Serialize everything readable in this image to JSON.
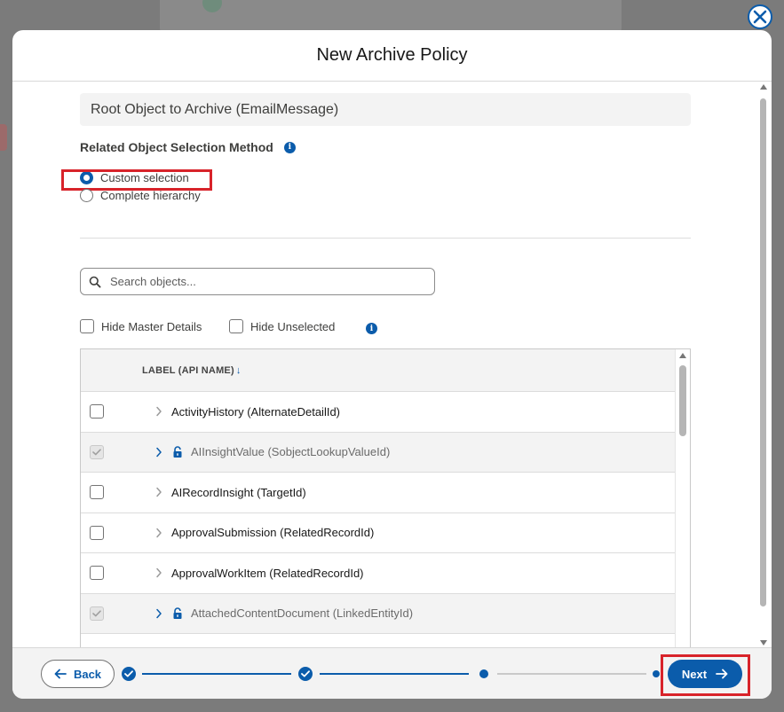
{
  "modal": {
    "title": "New Archive Policy"
  },
  "root_object": {
    "label": "Root Object to Archive (EmailMessage)"
  },
  "selection_method": {
    "label": "Related Object Selection Method",
    "options": [
      {
        "label": "Custom selection",
        "selected": true
      },
      {
        "label": "Complete hierarchy",
        "selected": false
      }
    ]
  },
  "search": {
    "placeholder": "Search objects..."
  },
  "filters": {
    "hide_master_details": "Hide Master Details",
    "hide_unselected": "Hide Unselected"
  },
  "table": {
    "column_header": "LABEL (API NAME)",
    "sort_indicator": "↓",
    "rows": [
      {
        "label": "ActivityHistory (AlternateDetailId)",
        "locked": false,
        "checked": false
      },
      {
        "label": "AIInsightValue (SobjectLookupValueId)",
        "locked": true,
        "checked": true
      },
      {
        "label": "AIRecordInsight (TargetId)",
        "locked": false,
        "checked": false
      },
      {
        "label": "ApprovalSubmission (RelatedRecordId)",
        "locked": false,
        "checked": false
      },
      {
        "label": "ApprovalWorkItem (RelatedRecordId)",
        "locked": false,
        "checked": false
      },
      {
        "label": "AttachedContentDocument (LinkedEntityId)",
        "locked": true,
        "checked": true
      }
    ]
  },
  "footer": {
    "back_label": "Back",
    "next_label": "Next"
  },
  "colors": {
    "brand": "#0b5cab",
    "highlight": "#d8232a"
  }
}
